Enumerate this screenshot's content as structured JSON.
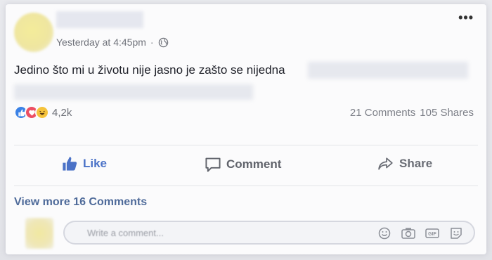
{
  "post": {
    "timestamp": "Yesterday at 4:45pm",
    "separator": "·",
    "text": "Jedino što mi u životu nije jasno je zašto se nijedna",
    "more_icon": "ellipsis-icon",
    "privacy_icon": "globe-icon"
  },
  "reactions": {
    "types": [
      "like",
      "love",
      "haha"
    ],
    "count": "4,2k"
  },
  "stats": {
    "comments": "21 Comments",
    "shares": "105 Shares"
  },
  "actions": {
    "like": "Like",
    "comment": "Comment",
    "share": "Share"
  },
  "comments": {
    "view_more": "View more 16 Comments",
    "placeholder": "Write a comment..."
  },
  "colors": {
    "like_blue": "#4b72c7",
    "love_red": "#ec4f63",
    "haha_yellow": "#f5c33b",
    "link": "#4f6b9a"
  }
}
